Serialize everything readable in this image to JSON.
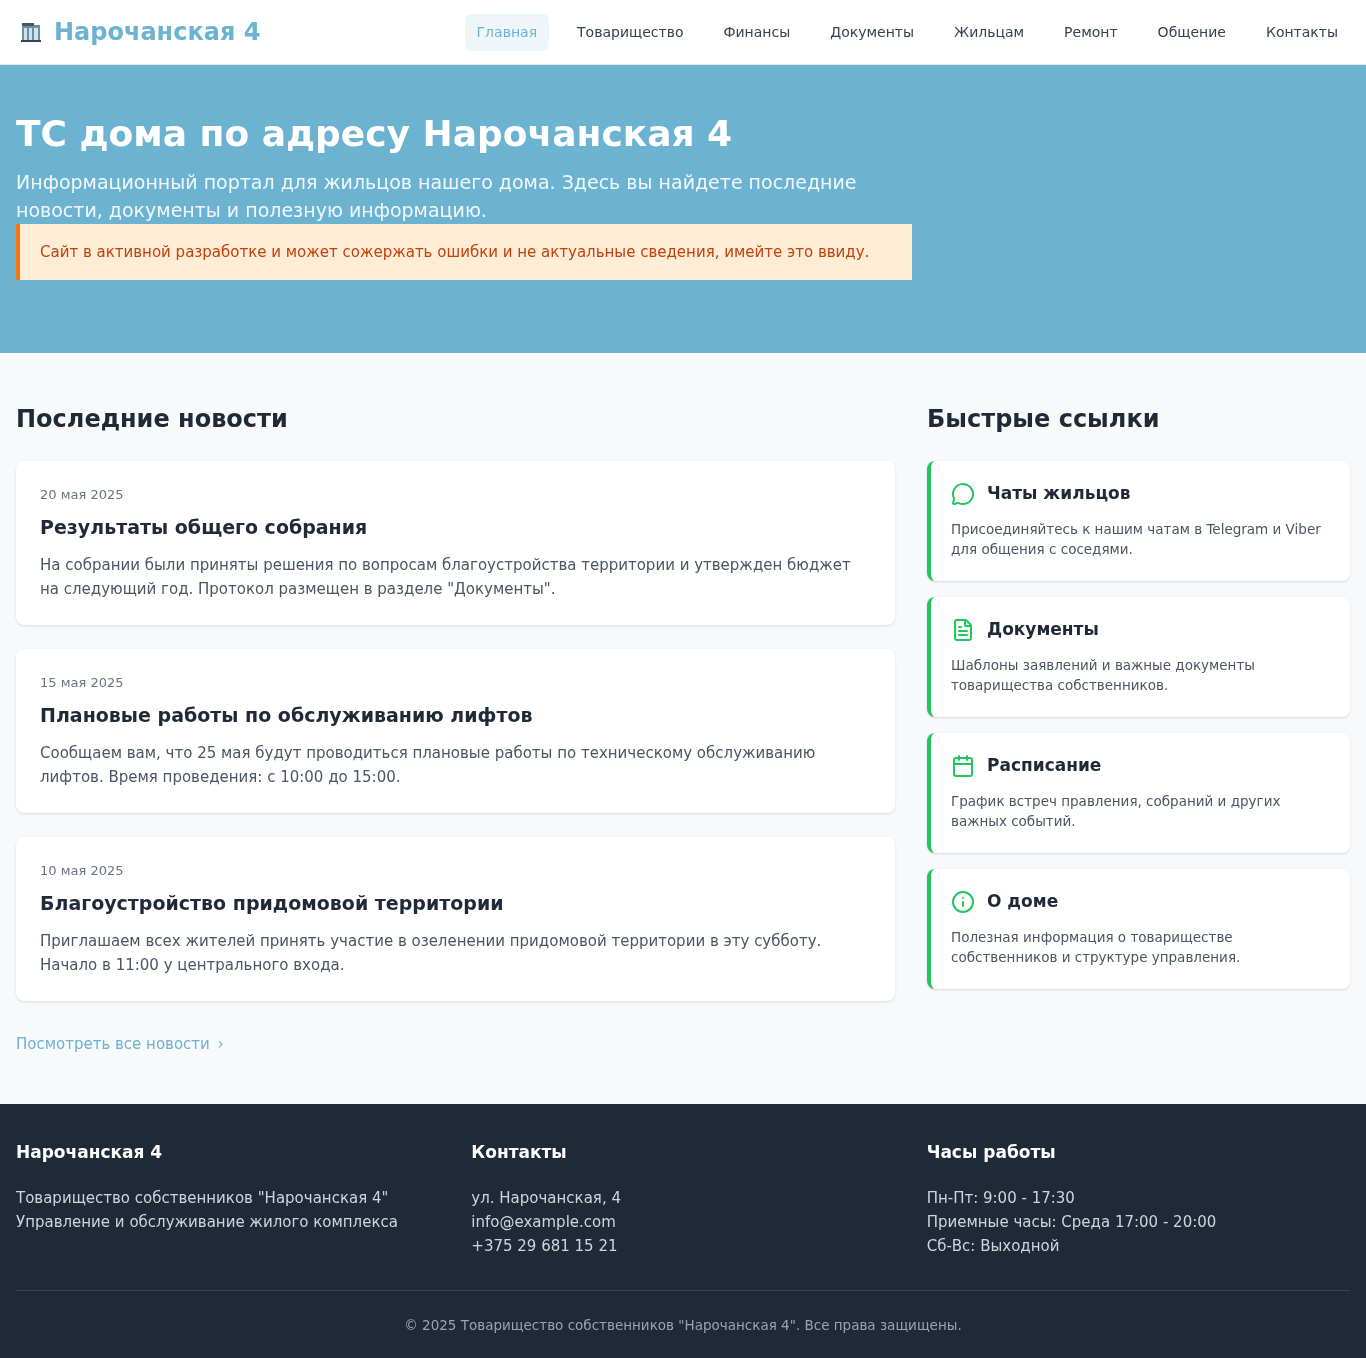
{
  "header": {
    "logo": "Нарочанская 4",
    "nav": [
      {
        "label": "Главная",
        "selected": true
      },
      {
        "label": "Товарищество",
        "selected": false
      },
      {
        "label": "Финансы",
        "selected": false
      },
      {
        "label": "Документы",
        "selected": false
      },
      {
        "label": "Жильцам",
        "selected": false
      },
      {
        "label": "Ремонт",
        "selected": false
      },
      {
        "label": "Общение",
        "selected": false
      },
      {
        "label": "Контакты",
        "selected": false
      }
    ]
  },
  "hero": {
    "title": "ТС дома по адресу Нарочанская 4",
    "subtitle": "Информационный портал для жильцов нашего дома. Здесь вы найдете последние новости, документы и полезную информацию.",
    "warning": "Сайт в активной разработке и может сожержать ошибки и не актуальные сведения, имейте это ввиду."
  },
  "news": {
    "title": "Последние новости",
    "items": [
      {
        "date": "20 мая 2025",
        "title": "Результаты общего собрания",
        "text": "На собрании были приняты решения по вопросам благоустройства территории и утвержден бюджет на следующий год. Протокол размещен в разделе \"Документы\"."
      },
      {
        "date": "15 мая 2025",
        "title": "Плановые работы по обслуживанию лифтов",
        "text": "Сообщаем вам, что 25 мая будут проводиться плановые работы по техническому обслуживанию лифтов. Время проведения: с 10:00 до 15:00."
      },
      {
        "date": "10 мая 2025",
        "title": "Благоустройство придомовой территории",
        "text": "Приглашаем всех жителей принять участие в озеленении придомовой территории в эту субботу. Начало в 11:00 у центрального входа."
      }
    ],
    "all_link": "Посмотреть все новости",
    "all_link_arrow": "›"
  },
  "quick_links": {
    "title": "Быстрые ссылки",
    "items": [
      {
        "kind": "chat",
        "title": "Чаты жильцов",
        "text": "Присоединяйтесь к нашим чатам в Telegram и Viber для общения с соседями."
      },
      {
        "kind": "document",
        "title": "Документы",
        "text": "Шаблоны заявлений и важные документы товарищества собственников."
      },
      {
        "kind": "calendar",
        "title": "Расписание",
        "text": "График встреч правления, собраний и других важных событий."
      },
      {
        "kind": "info",
        "title": "О доме",
        "text": "Полезная информация о товариществе собственников и структуре управления."
      }
    ]
  },
  "footer": {
    "columns": [
      {
        "title": "Нарочанская 4",
        "lines": [
          "Товарищество собственников \"Нарочанская 4\"",
          "Управление и обслуживание жилого комплекса"
        ]
      },
      {
        "title": "Контакты",
        "lines": [
          "ул. Нарочанская, 4",
          "info@example.com",
          "+375 29 681 15 21"
        ]
      },
      {
        "title": "Часы работы",
        "lines": [
          "Пн-Пт: 9:00 - 17:30",
          "Приемные часы: Среда 17:00 - 20:00",
          "Сб-Вс: Выходной"
        ]
      }
    ],
    "copyright": "© 2025 Товарищество собственников \"Нарочанская 4\". Все права защищены."
  }
}
